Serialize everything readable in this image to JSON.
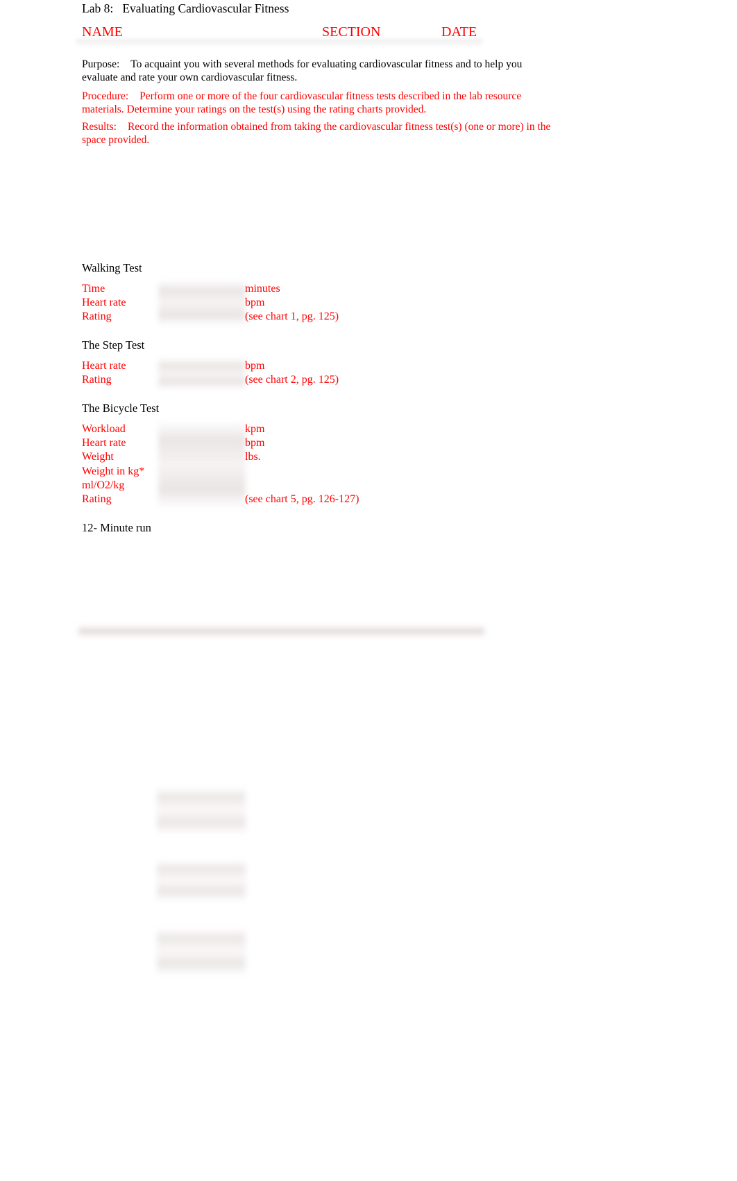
{
  "document": {
    "title": "Lab 8:   Evaluating Cardiovascular Fitness"
  },
  "header": {
    "name_label": "NAME",
    "section_label": "SECTION",
    "date_label": "DATE"
  },
  "intro": {
    "purpose_label": "Purpose:",
    "purpose_text": "To acquaint you with several methods for evaluating cardiovascular fitness and to help you evaluate and rate your own cardiovascular fitness.",
    "procedure_label": "Procedure:",
    "procedure_text": "Perform one or more of the four cardiovascular fitness tests described in the lab resource materials. Determine your ratings on the test(s) using the rating charts provided.",
    "results_label": "Results:",
    "results_text": "Record the information obtained from taking the cardiovascular fitness test(s) (one or more) in the space provided."
  },
  "sections": [
    {
      "title": "Walking Test",
      "rows": [
        {
          "label": "Time",
          "value": "",
          "unit": "minutes"
        },
        {
          "label": "Heart rate",
          "value": "",
          "unit": "bpm"
        },
        {
          "label": "Rating",
          "value": "",
          "unit": "(see chart 1, pg. 125)"
        }
      ]
    },
    {
      "title": "The Step Test",
      "rows": [
        {
          "label": "Heart rate",
          "value": "",
          "unit": "bpm"
        },
        {
          "label": "Rating",
          "value": "",
          "unit": "(see chart 2, pg. 125)"
        }
      ]
    },
    {
      "title": "The Bicycle Test",
      "rows": [
        {
          "label": "Workload",
          "value": "",
          "unit": "kpm"
        },
        {
          "label": "Heart rate",
          "value": "",
          "unit": "bpm"
        },
        {
          "label": "Weight",
          "value": "",
          "unit": "lbs."
        },
        {
          "label": "Weight in kg*",
          "value": "",
          "unit": ""
        },
        {
          "label": "ml/O2/kg",
          "value": "",
          "unit": ""
        },
        {
          "label": "Rating",
          "value": "",
          "unit": "(see chart 5, pg. 126-127)"
        }
      ]
    },
    {
      "title": "12- Minute run",
      "rows": []
    }
  ],
  "colors": {
    "text": "#000000",
    "accent_red": "#ff0000",
    "page_background": "#ffffff",
    "blank_field": "#ece7e7"
  }
}
